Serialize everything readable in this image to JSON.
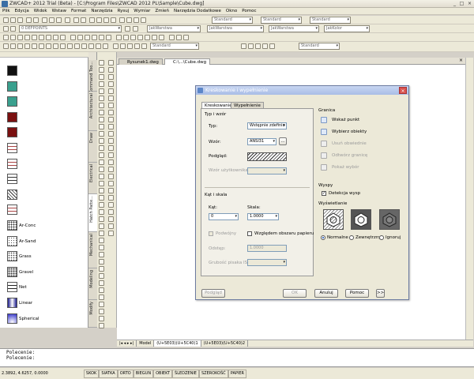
{
  "window": {
    "title": "ZWCAD+ 2012 Trial (Beta) - [C:\\Program Files\\ZWCAD 2012 PL\\Sample\\Cube.dwg]"
  },
  "menu": [
    "Plik",
    "Edycja",
    "Widok",
    "Wstaw",
    "Format",
    "Narzędzia",
    "Rysuj",
    "Wymiar",
    "Zmień",
    "Narzędzia Dodatkowe",
    "Okno",
    "Pomoc"
  ],
  "toolbars": {
    "style1": "Standard",
    "style2": "Standard",
    "style3": "Standard",
    "layer": "0 DEFPOINTS",
    "color": "JakWarstwa",
    "linetype": "JakWarstwa",
    "lineweight": "JakWarstwa",
    "plotstyle": "JakKolor",
    "style4": "Standard",
    "style5": "Standard"
  },
  "palette": {
    "items": [
      {
        "label": "",
        "color": "#111111"
      },
      {
        "label": "",
        "color": "#3aa08e"
      },
      {
        "label": "",
        "color": "#3aa08e"
      },
      {
        "label": "",
        "color": "#7a1010"
      },
      {
        "label": "",
        "color": "#7a1010"
      },
      {
        "label": "",
        "icon": "brick-hatch-icon"
      },
      {
        "label": "",
        "icon": "brick-hatch-icon"
      },
      {
        "label": "",
        "icon": "grid-hatch-icon"
      },
      {
        "label": "",
        "icon": "diagonal-hatch-icon"
      },
      {
        "label": "",
        "icon": "brick-hatch-icon"
      },
      {
        "label": "Ar-Conc",
        "icon": "concrete-hatch-icon"
      },
      {
        "label": "Ar-Sand",
        "icon": "sand-hatch-icon"
      },
      {
        "label": "Grass",
        "icon": "grass-hatch-icon"
      },
      {
        "label": "Gravel",
        "icon": "gravel-hatch-icon"
      },
      {
        "label": "Net",
        "icon": "net-hatch-icon"
      },
      {
        "label": "Linear",
        "icon": "linear-gradient-icon"
      },
      {
        "label": "Spherical",
        "icon": "spherical-gradient-icon"
      }
    ],
    "tabs": [
      "Command Too...",
      "Architectural",
      "Draw",
      "Electrical",
      "Hatch Patte...",
      "Mechanical",
      "Modeling",
      "Modify"
    ]
  },
  "document_tabs": [
    "Rysunek1.dwg",
    "C:\\...\\Cube.dwg"
  ],
  "layout_tabs": [
    "Model",
    "(U+5E03)(U+5C40)1",
    "(U+5E03)(U+5C40)2"
  ],
  "command": {
    "lines": [
      "Polecenie:",
      "Polecenie:"
    ]
  },
  "status": {
    "coords": "2.3892, 4.6257, 0.0000",
    "toggles": [
      "SKOK",
      "SIATKA",
      "ORTO",
      "BIEGUN",
      "OBIEKT",
      "ŚLEDZENIE",
      "SZEROKOŚĆ",
      "PAPIER"
    ]
  },
  "dialog": {
    "title": "Kreskowanie i wypełnienie",
    "tabs": [
      "Kreskowanie",
      "Wypełnienie"
    ],
    "type_section": "Typ i wzór",
    "type_label": "Typ:",
    "type_value": "Wstępnie zdefinio",
    "pattern_label": "Wzór:",
    "pattern_value": "ANSI31",
    "pattern_browse": "...",
    "preview_label": "Podgląd:",
    "custom_label": "Wzór użytkownika:",
    "angle_section": "Kąt i skala",
    "angle_label": "Kąt:",
    "angle_value": "0",
    "scale_label": "Skala:",
    "scale_value": "1.0000",
    "double_label": "Podwójny",
    "paper_label": "Względem obszaru papieru",
    "spacing_label": "Odstęp:",
    "spacing_value": "1.0000",
    "iso_label": "Grubość pisaka ISO:",
    "boundary_section": "Granica",
    "boundary_buttons": [
      {
        "label": "Wskaż punkt",
        "enabled": true
      },
      {
        "label": "Wybierz obiekty",
        "enabled": true
      },
      {
        "label": "Usuń obwiednie",
        "enabled": false
      },
      {
        "label": "Odtwórz granicę",
        "enabled": false
      },
      {
        "label": "Pokaż wybór",
        "enabled": false
      }
    ],
    "islands_section": "Wyspy",
    "islands_check": "Detekcja wysp",
    "display_section": "Wyświetlanie",
    "display_options": [
      {
        "label": "Normalne",
        "selected": true
      },
      {
        "label": "Zewnętrzny",
        "selected": false
      },
      {
        "label": "Ignoruj",
        "selected": false
      }
    ],
    "buttons": {
      "preview": "Podgląd",
      "ok": "OK",
      "cancel": "Anuluj",
      "help": "Pomoc",
      "more": ">>"
    }
  }
}
